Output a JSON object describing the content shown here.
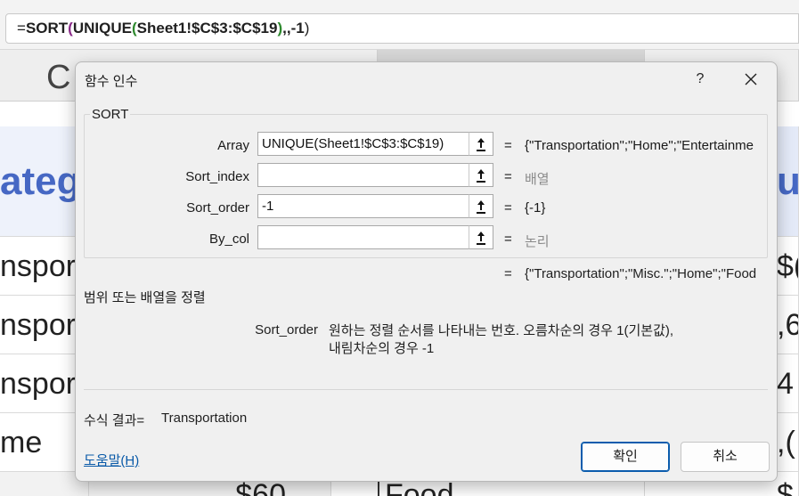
{
  "formula_bar": {
    "prefix": "=",
    "fn_sort": "SORT",
    "open1": "(",
    "fn_unique": "UNIQUE",
    "open2": "(",
    "ref": "Sheet1!$C$3:$C$19",
    "close2": ")",
    "rest": ",,-1",
    "close1": ")"
  },
  "sheet": {
    "col_header_c": "C",
    "col_header_right": "",
    "header_left": "ateg",
    "header_right": "u",
    "rows_left": [
      "nsport",
      "nsport",
      "nsport",
      "me",
      ""
    ],
    "rows_right": [
      "$(",
      ",6",
      "4",
      ",(",
      "$"
    ],
    "row_mid_last": "$60",
    "row_mid2_last": "Food"
  },
  "dialog": {
    "title": "함수 인수",
    "help_symbol": "?",
    "function_name": "SORT",
    "args": [
      {
        "label": "Array",
        "value": "UNIQUE(Sheet1!$C$3:$C$19)",
        "eq": "=",
        "result": "{\"Transportation\";\"Home\";\"Entertainme"
      },
      {
        "label": "Sort_index",
        "value": "",
        "eq": "=",
        "result": "배열"
      },
      {
        "label": "Sort_order",
        "value": "-1",
        "eq": "=",
        "result": "{-1}"
      },
      {
        "label": "By_col",
        "value": "",
        "eq": "=",
        "result": "논리"
      }
    ],
    "function_result_eq": "=",
    "function_result": "{\"Transportation\";\"Misc.\";\"Home\";\"Food",
    "description": "범위 또는 배열을 정렬",
    "help_arg_name": "Sort_order",
    "help_arg_text_line1": "원하는 정렬 순서를 나타내는 번호. 오름차순의 경우 1(기본값),",
    "help_arg_text_line2": "내림차순의 경우 -1",
    "formula_result_label": "수식 결과=",
    "formula_result_value": "Transportation",
    "help_link": "도움말(H)",
    "ok_label": "확인",
    "cancel_label": "취소"
  },
  "colors": {
    "accent": "#0b5cad",
    "header_blue": "#4668c4",
    "muted": "#8a8a8a"
  }
}
